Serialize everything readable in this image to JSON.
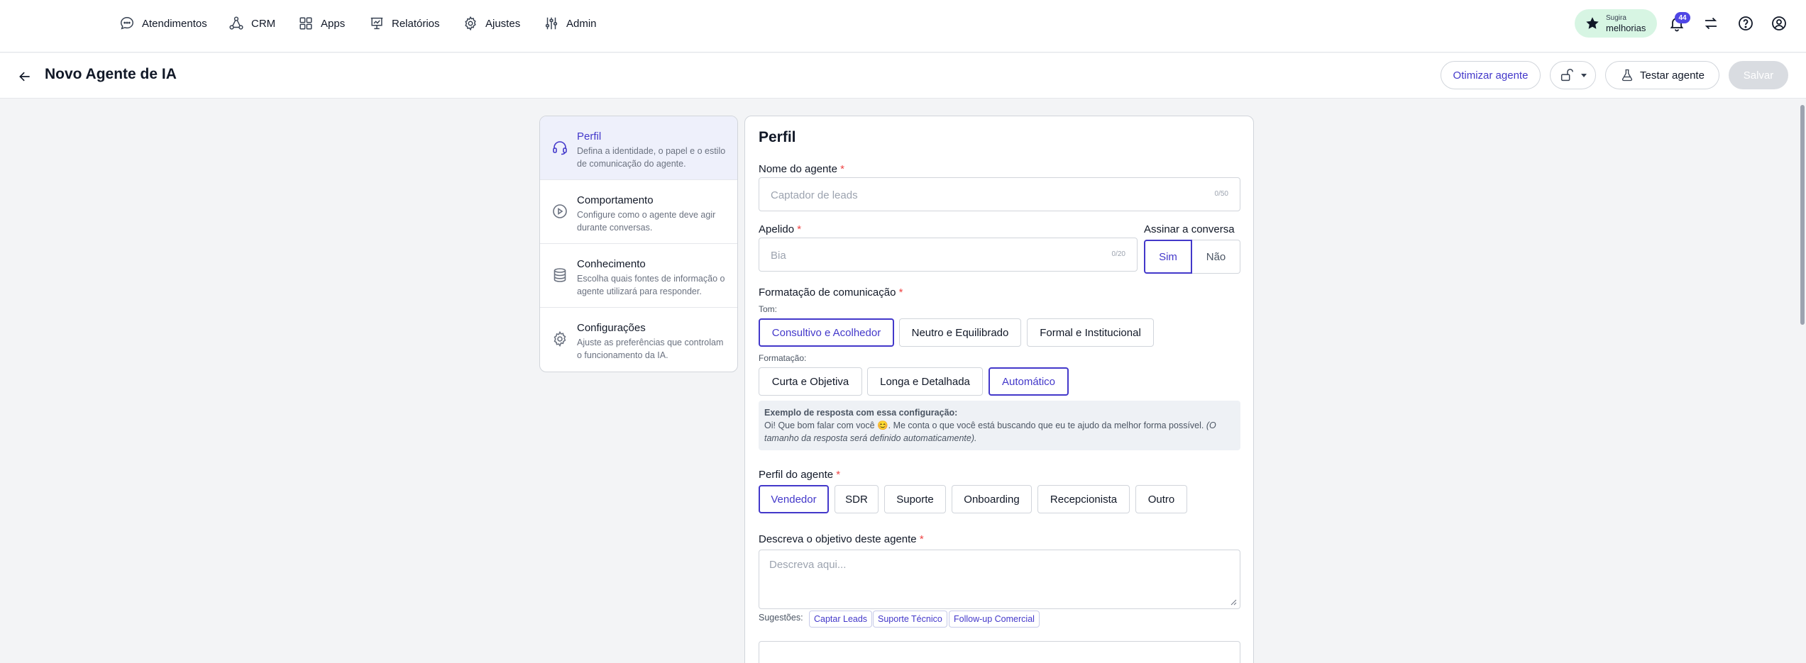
{
  "nav": {
    "items": [
      {
        "label": "Atendimentos",
        "icon": "chat-bubble-icon"
      },
      {
        "label": "CRM",
        "icon": "nodes-icon"
      },
      {
        "label": "Apps",
        "icon": "grid-icon"
      },
      {
        "label": "Relatórios",
        "icon": "presentation-chart-icon"
      },
      {
        "label": "Ajustes",
        "icon": "gear-icon"
      },
      {
        "label": "Admin",
        "icon": "sliders-icon"
      }
    ],
    "suggest": {
      "line1": "Sugira",
      "line2": "melhorias"
    },
    "notifications": "44"
  },
  "header": {
    "title": "Novo Agente de IA",
    "optimize_label": "Otimizar agente",
    "test_label": "Testar agente",
    "save_label": "Salvar"
  },
  "steps": [
    {
      "title": "Perfil",
      "desc": "Defina a identidade, o papel e o estilo de comunicação do agente."
    },
    {
      "title": "Comportamento",
      "desc": "Configure como o agente deve agir durante conversas."
    },
    {
      "title": "Conhecimento",
      "desc": "Escolha quais fontes de informação o agente utilizará para responder."
    },
    {
      "title": "Configurações",
      "desc": "Ajuste as preferências que controlam o funcionamento da IA."
    }
  ],
  "form": {
    "title": "Perfil",
    "name": {
      "label": "Nome do agente",
      "placeholder": "Captador de leads",
      "counter": "0/50"
    },
    "nickname": {
      "label": "Apelido",
      "placeholder": "Bia",
      "counter": "0/20"
    },
    "sign": {
      "label": "Assinar a conversa",
      "yes": "Sim",
      "no": "Não",
      "selected": "Sim"
    },
    "communication": {
      "label": "Formatação de comunicação",
      "tone_label": "Tom:",
      "tones": [
        "Consultivo e Acolhedor",
        "Neutro e Equilibrado",
        "Formal e Institucional"
      ],
      "tone_selected": "Consultivo e Acolhedor",
      "format_label": "Formatação:",
      "formats": [
        "Curta e Objetiva",
        "Longa e Detalhada",
        "Automático"
      ],
      "format_selected": "Automático"
    },
    "example": {
      "heading": "Exemplo de resposta com essa configuração:",
      "text1": "Oi! Que bom falar com você 😊. Me conta o que você está buscando que eu te ajudo da melhor forma possível.",
      "note": "(O tamanho da resposta será definido automaticamente)."
    },
    "profile": {
      "label": "Perfil do agente",
      "options": [
        "Vendedor",
        "SDR",
        "Suporte",
        "Onboarding",
        "Recepcionista",
        "Outro"
      ],
      "selected": "Vendedor"
    },
    "objective": {
      "label": "Descreva o objetivo deste agente",
      "placeholder": "Descreva aqui...",
      "suggestions_label": "Sugestões:",
      "suggestions": [
        "Captar Leads",
        "Suporte Técnico",
        "Follow-up Comercial"
      ]
    }
  }
}
